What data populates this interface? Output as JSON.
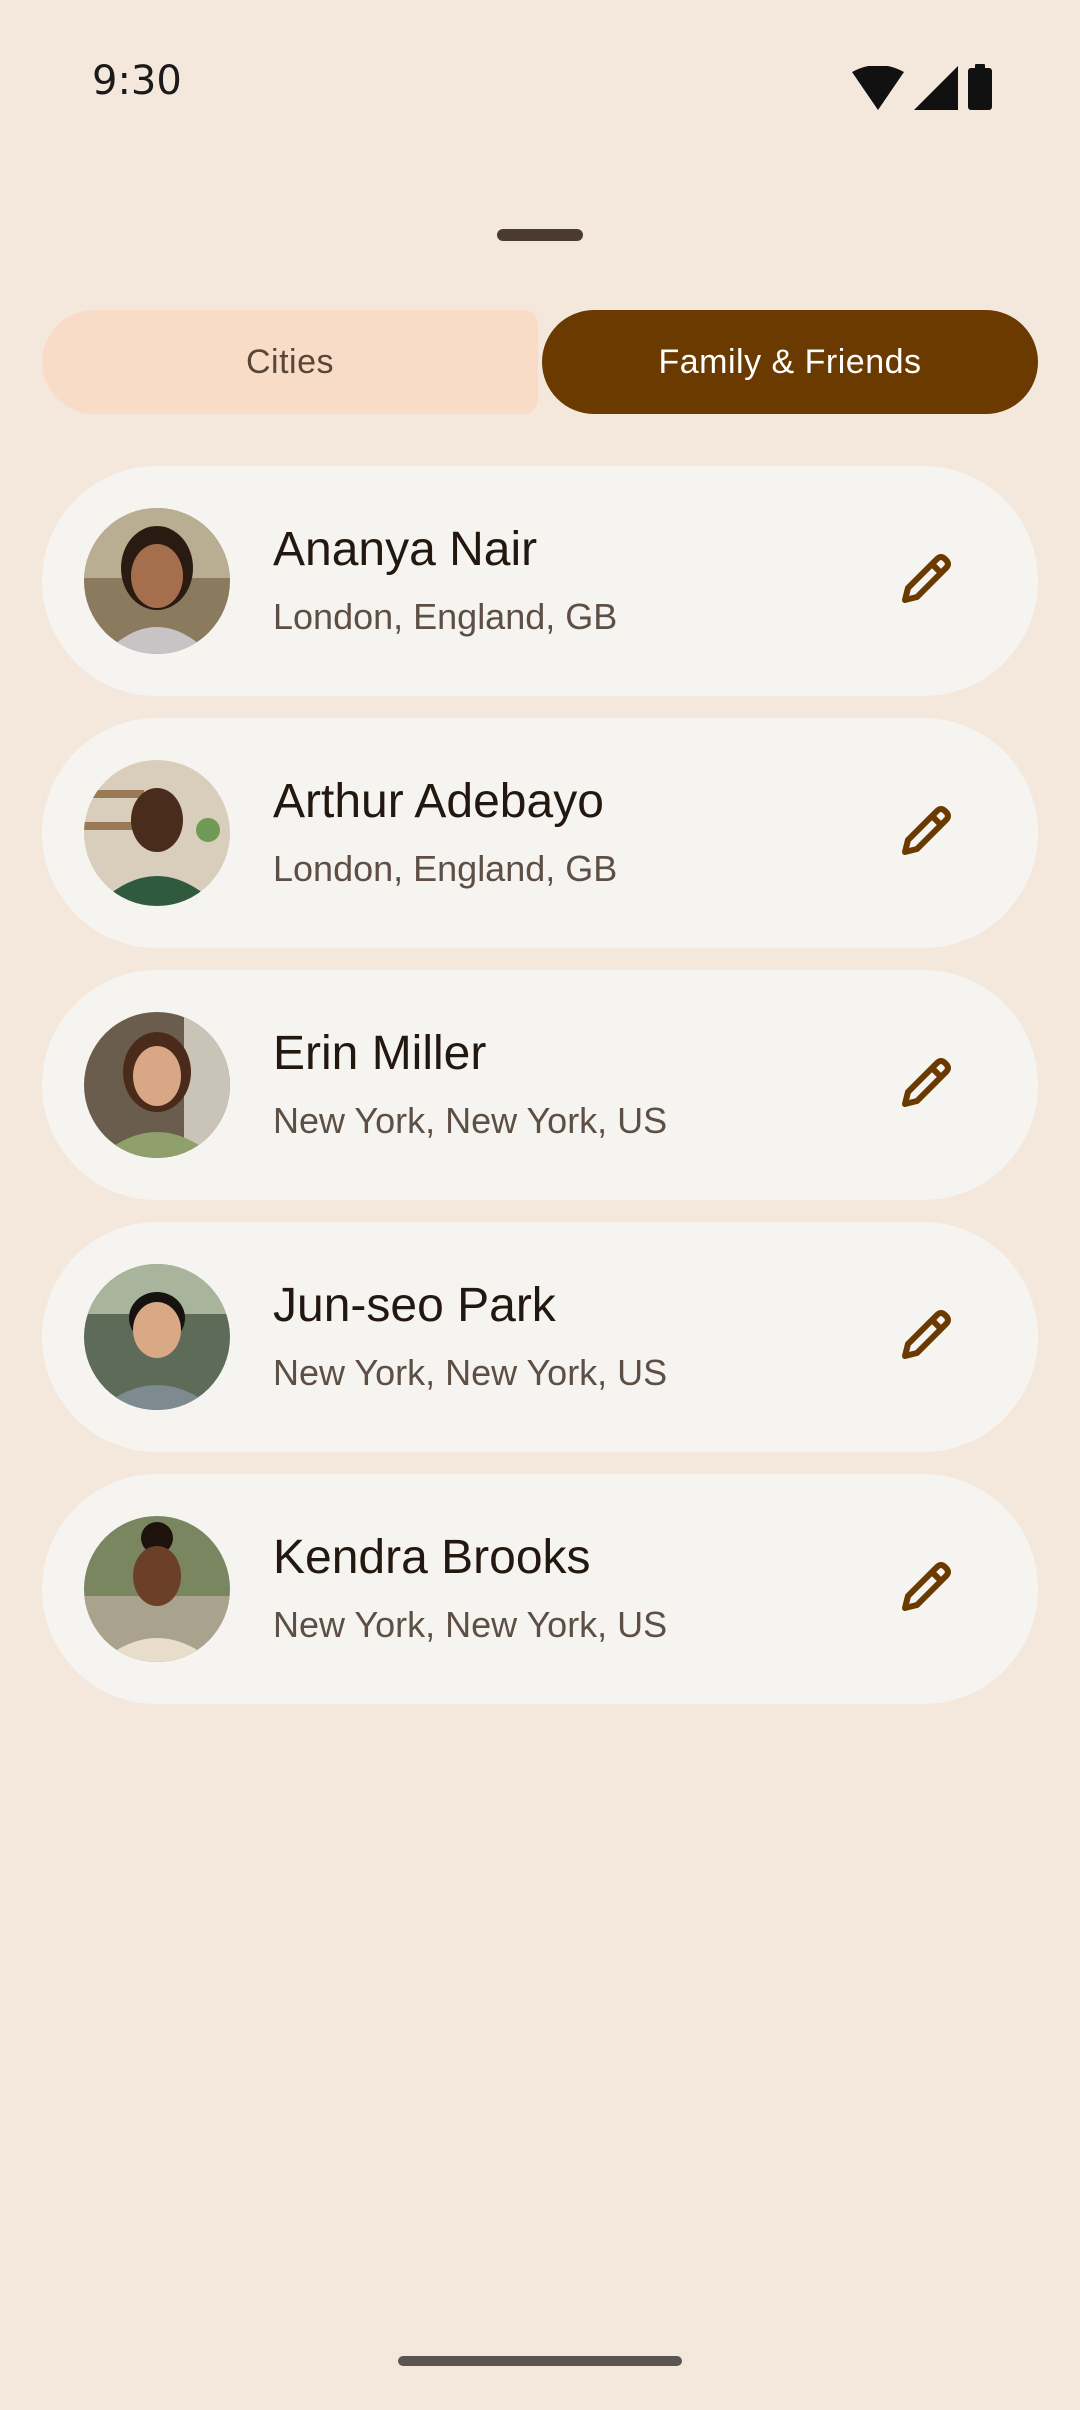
{
  "status_bar": {
    "time": "9:30",
    "icons": [
      "wifi-icon",
      "cellular-signal-icon",
      "battery-icon"
    ]
  },
  "tabs": {
    "cities_label": "Cities",
    "family_label": "Family & Friends",
    "selected": "Family & Friends"
  },
  "contacts": [
    {
      "name": "Ananya Nair",
      "location": "London, England, GB"
    },
    {
      "name": "Arthur Adebayo",
      "location": "London, England, GB"
    },
    {
      "name": "Erin Miller",
      "location": "New York, New York, US"
    },
    {
      "name": "Jun-seo Park",
      "location": "New York, New York, US"
    },
    {
      "name": "Kendra Brooks",
      "location": "New York, New York, US"
    }
  ],
  "colors": {
    "background": "#f4e8dc",
    "selected_tab": "#6a3a00",
    "unselected_tab": "#f9dcc8",
    "card": "#f6f4f0",
    "edit_icon": "#6a3a00"
  }
}
